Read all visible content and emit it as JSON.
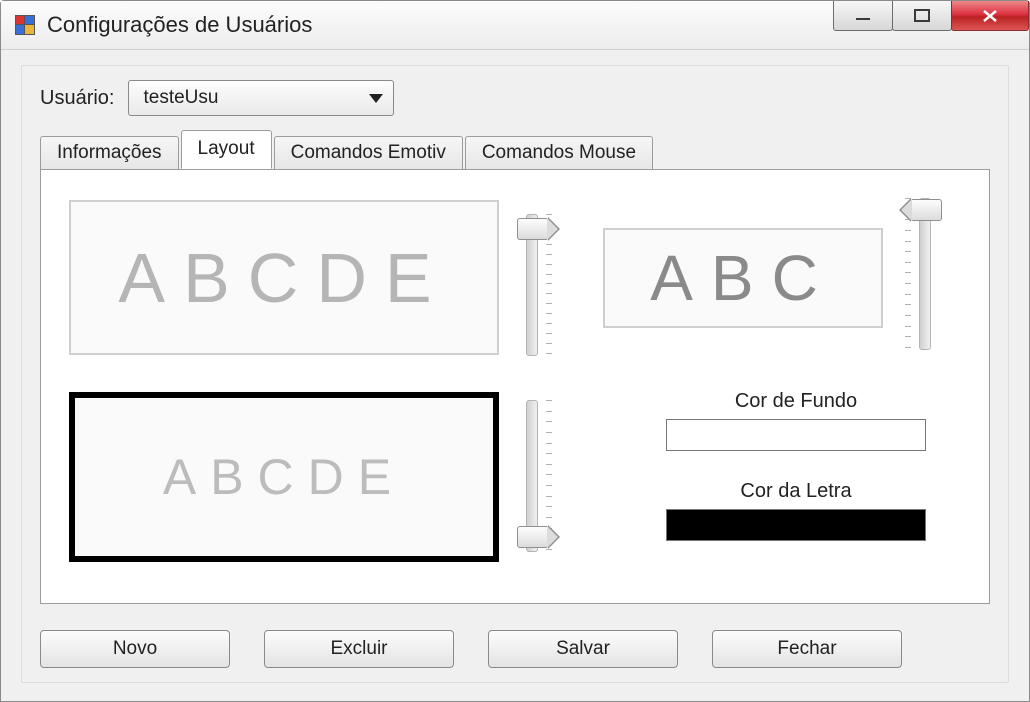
{
  "window": {
    "title": "Configurações de Usuários"
  },
  "user": {
    "label": "Usuário:",
    "selected": "testeUsu"
  },
  "tabs": [
    {
      "label": "Informações"
    },
    {
      "label": "Layout"
    },
    {
      "label": "Comandos Emotiv"
    },
    {
      "label": "Comandos Mouse"
    }
  ],
  "active_tab_index": 1,
  "layout": {
    "preview1_text": "ABCDE",
    "preview2_text": "ABC",
    "preview3_text": "ABCDE",
    "bg_label": "Cor de Fundo",
    "fg_label": "Cor da Letra",
    "bg_color": "#ffffff",
    "fg_color": "#000000"
  },
  "buttons": {
    "new": "Novo",
    "delete": "Excluir",
    "save": "Salvar",
    "close": "Fechar"
  }
}
